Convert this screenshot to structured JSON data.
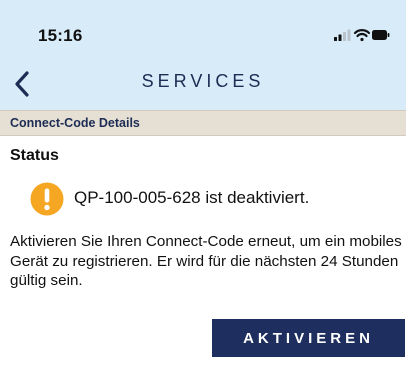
{
  "status_bar": {
    "time": "15:16",
    "icons": [
      "signal-icon",
      "wifi-icon",
      "battery-icon"
    ]
  },
  "nav": {
    "back_icon": "chevron-left-icon",
    "title": "SERVICES"
  },
  "section": {
    "label": "Connect-Code Details"
  },
  "status": {
    "heading": "Status",
    "icon": "warning-icon",
    "message": "QP-100-005-628 ist deaktiviert.",
    "description": "Aktivieren Sie Ihren Connect-Code erneut, um ein mobiles Gerät zu registrieren. Er wird für die nächsten 24 Stunden gültig sein."
  },
  "actions": {
    "activate_label": "AKTIVIEREN"
  },
  "colors": {
    "header_background": "#d7ebf8",
    "section_background": "#e6e0d4",
    "brand_navy": "#1e2e5e",
    "warning_orange": "#f5a623"
  }
}
